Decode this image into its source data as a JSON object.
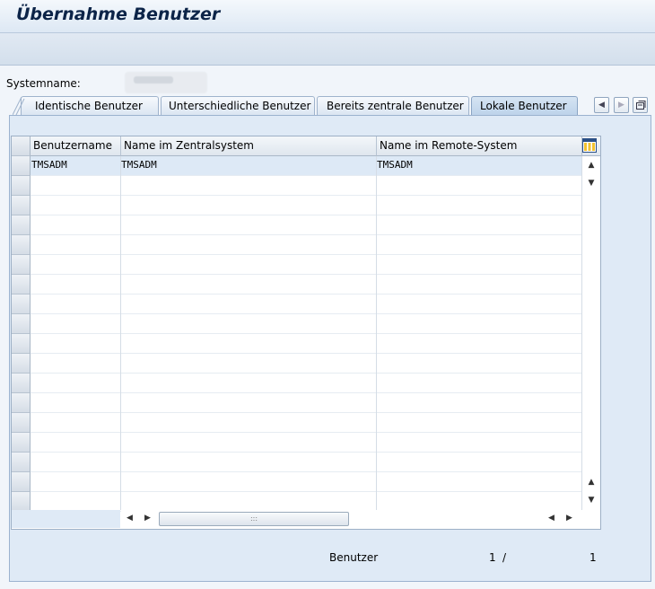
{
  "window": {
    "title": "Übernahme Benutzer"
  },
  "system": {
    "label": "Systemname:",
    "value": ""
  },
  "tabs": [
    {
      "label": "Identische Benutzer",
      "active": false
    },
    {
      "label": "Unterschiedliche Benutzer",
      "active": false
    },
    {
      "label": "Bereits zentrale Benutzer",
      "active": false
    },
    {
      "label": "Lokale Benutzer",
      "active": true
    }
  ],
  "table": {
    "columns": [
      "Benutzername",
      "Name im Zentralsystem",
      "Name im Remote-System"
    ],
    "rows": [
      [
        "TMSADM",
        "TMSADM",
        "TMSADM"
      ]
    ]
  },
  "footer": {
    "label": "Benutzer",
    "current": "1",
    "separator": "/",
    "total": "1"
  },
  "icons": {
    "tab_prev": "chevron-left-icon",
    "tab_next": "chevron-right-icon",
    "tab_list": "tab-list-icon",
    "column_settings": "column-layout-icon",
    "scroll_up": "triangle-up-icon",
    "scroll_down": "triangle-down-icon",
    "scroll_left": "triangle-left-icon",
    "scroll_right": "triangle-right-icon"
  },
  "colors": {
    "title": "#0c2448",
    "panel": "#dfeaf6",
    "selected_row": "#dde9f6"
  }
}
